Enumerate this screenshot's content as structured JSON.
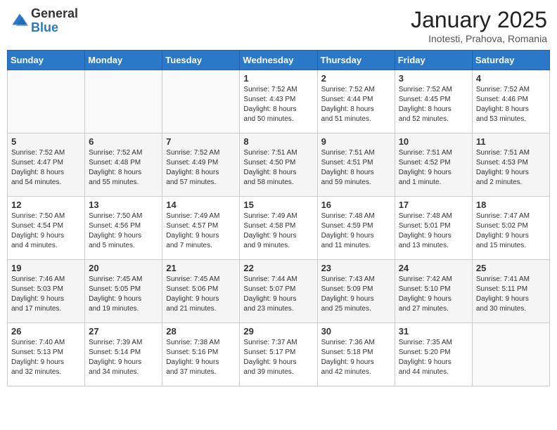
{
  "header": {
    "logo_general": "General",
    "logo_blue": "Blue",
    "month_title": "January 2025",
    "location": "Inotesti, Prahova, Romania"
  },
  "weekdays": [
    "Sunday",
    "Monday",
    "Tuesday",
    "Wednesday",
    "Thursday",
    "Friday",
    "Saturday"
  ],
  "weeks": [
    [
      {
        "day": "",
        "info": ""
      },
      {
        "day": "",
        "info": ""
      },
      {
        "day": "",
        "info": ""
      },
      {
        "day": "1",
        "info": "Sunrise: 7:52 AM\nSunset: 4:43 PM\nDaylight: 8 hours\nand 50 minutes."
      },
      {
        "day": "2",
        "info": "Sunrise: 7:52 AM\nSunset: 4:44 PM\nDaylight: 8 hours\nand 51 minutes."
      },
      {
        "day": "3",
        "info": "Sunrise: 7:52 AM\nSunset: 4:45 PM\nDaylight: 8 hours\nand 52 minutes."
      },
      {
        "day": "4",
        "info": "Sunrise: 7:52 AM\nSunset: 4:46 PM\nDaylight: 8 hours\nand 53 minutes."
      }
    ],
    [
      {
        "day": "5",
        "info": "Sunrise: 7:52 AM\nSunset: 4:47 PM\nDaylight: 8 hours\nand 54 minutes."
      },
      {
        "day": "6",
        "info": "Sunrise: 7:52 AM\nSunset: 4:48 PM\nDaylight: 8 hours\nand 55 minutes."
      },
      {
        "day": "7",
        "info": "Sunrise: 7:52 AM\nSunset: 4:49 PM\nDaylight: 8 hours\nand 57 minutes."
      },
      {
        "day": "8",
        "info": "Sunrise: 7:51 AM\nSunset: 4:50 PM\nDaylight: 8 hours\nand 58 minutes."
      },
      {
        "day": "9",
        "info": "Sunrise: 7:51 AM\nSunset: 4:51 PM\nDaylight: 8 hours\nand 59 minutes."
      },
      {
        "day": "10",
        "info": "Sunrise: 7:51 AM\nSunset: 4:52 PM\nDaylight: 9 hours\nand 1 minute."
      },
      {
        "day": "11",
        "info": "Sunrise: 7:51 AM\nSunset: 4:53 PM\nDaylight: 9 hours\nand 2 minutes."
      }
    ],
    [
      {
        "day": "12",
        "info": "Sunrise: 7:50 AM\nSunset: 4:54 PM\nDaylight: 9 hours\nand 4 minutes."
      },
      {
        "day": "13",
        "info": "Sunrise: 7:50 AM\nSunset: 4:56 PM\nDaylight: 9 hours\nand 5 minutes."
      },
      {
        "day": "14",
        "info": "Sunrise: 7:49 AM\nSunset: 4:57 PM\nDaylight: 9 hours\nand 7 minutes."
      },
      {
        "day": "15",
        "info": "Sunrise: 7:49 AM\nSunset: 4:58 PM\nDaylight: 9 hours\nand 9 minutes."
      },
      {
        "day": "16",
        "info": "Sunrise: 7:48 AM\nSunset: 4:59 PM\nDaylight: 9 hours\nand 11 minutes."
      },
      {
        "day": "17",
        "info": "Sunrise: 7:48 AM\nSunset: 5:01 PM\nDaylight: 9 hours\nand 13 minutes."
      },
      {
        "day": "18",
        "info": "Sunrise: 7:47 AM\nSunset: 5:02 PM\nDaylight: 9 hours\nand 15 minutes."
      }
    ],
    [
      {
        "day": "19",
        "info": "Sunrise: 7:46 AM\nSunset: 5:03 PM\nDaylight: 9 hours\nand 17 minutes."
      },
      {
        "day": "20",
        "info": "Sunrise: 7:45 AM\nSunset: 5:05 PM\nDaylight: 9 hours\nand 19 minutes."
      },
      {
        "day": "21",
        "info": "Sunrise: 7:45 AM\nSunset: 5:06 PM\nDaylight: 9 hours\nand 21 minutes."
      },
      {
        "day": "22",
        "info": "Sunrise: 7:44 AM\nSunset: 5:07 PM\nDaylight: 9 hours\nand 23 minutes."
      },
      {
        "day": "23",
        "info": "Sunrise: 7:43 AM\nSunset: 5:09 PM\nDaylight: 9 hours\nand 25 minutes."
      },
      {
        "day": "24",
        "info": "Sunrise: 7:42 AM\nSunset: 5:10 PM\nDaylight: 9 hours\nand 27 minutes."
      },
      {
        "day": "25",
        "info": "Sunrise: 7:41 AM\nSunset: 5:11 PM\nDaylight: 9 hours\nand 30 minutes."
      }
    ],
    [
      {
        "day": "26",
        "info": "Sunrise: 7:40 AM\nSunset: 5:13 PM\nDaylight: 9 hours\nand 32 minutes."
      },
      {
        "day": "27",
        "info": "Sunrise: 7:39 AM\nSunset: 5:14 PM\nDaylight: 9 hours\nand 34 minutes."
      },
      {
        "day": "28",
        "info": "Sunrise: 7:38 AM\nSunset: 5:16 PM\nDaylight: 9 hours\nand 37 minutes."
      },
      {
        "day": "29",
        "info": "Sunrise: 7:37 AM\nSunset: 5:17 PM\nDaylight: 9 hours\nand 39 minutes."
      },
      {
        "day": "30",
        "info": "Sunrise: 7:36 AM\nSunset: 5:18 PM\nDaylight: 9 hours\nand 42 minutes."
      },
      {
        "day": "31",
        "info": "Sunrise: 7:35 AM\nSunset: 5:20 PM\nDaylight: 9 hours\nand 44 minutes."
      },
      {
        "day": "",
        "info": ""
      }
    ]
  ]
}
